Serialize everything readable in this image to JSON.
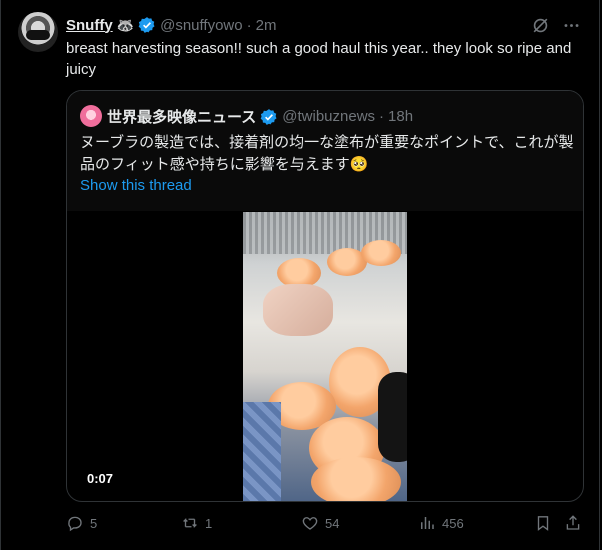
{
  "tweet": {
    "author_name": "Snuffy",
    "author_emoji": "🦝",
    "handle": "@snuffyowo",
    "separator": "·",
    "time": "2m",
    "text": "breast harvesting season!! such a good haul this year.. they look so ripe and juicy"
  },
  "quote": {
    "author_name": "世界最多映像ニュース",
    "handle": "@twibuznews",
    "separator": "·",
    "time": "18h",
    "text": "ヌーブラの製造では、接着剤の均一な塗布が重要なポイントで、これが製品のフィット感や持ちに影響を与えます🥺",
    "show_thread": "Show this thread",
    "video_duration": "0:07"
  },
  "actions": {
    "replies": "5",
    "retweets": "1",
    "likes": "54",
    "views": "456"
  },
  "colors": {
    "background": "#000000",
    "text": "#e7e9ea",
    "muted": "#71767b",
    "accent": "#1d9bf0",
    "border": "#2f3336"
  },
  "icons": [
    "verified-badge-icon",
    "grok-icon",
    "more-icon",
    "reply-icon",
    "retweet-icon",
    "like-icon",
    "views-icon",
    "bookmark-icon",
    "share-icon"
  ]
}
